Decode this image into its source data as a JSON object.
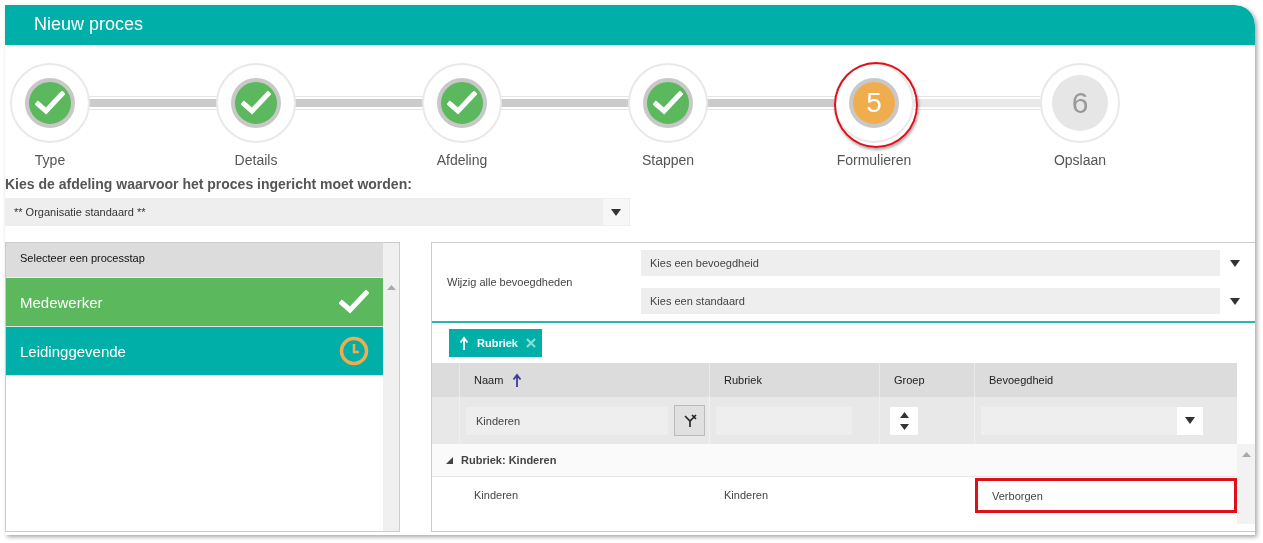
{
  "window": {
    "title": "Nieuw proces"
  },
  "steps": [
    {
      "label": "Type",
      "completed": true,
      "selected": false
    },
    {
      "label": "Details",
      "completed": true,
      "selected": false
    },
    {
      "label": "Afdeling",
      "completed": true,
      "selected": false
    },
    {
      "label": "Stappen",
      "completed": true,
      "selected": false
    },
    {
      "label": "Formulieren",
      "completed": false,
      "selected": true,
      "number": "5",
      "annotated": true
    },
    {
      "label": "Opslaan",
      "completed": false,
      "selected": false,
      "number": "6"
    }
  ],
  "department": {
    "label": "Kies de afdeling waarvoor het proces ingericht moet worden:",
    "value": "** Organisatie standaard **"
  },
  "process_steps": {
    "header": "Selecteer een processtap",
    "items": [
      {
        "label": "Medewerker",
        "completed": true
      },
      {
        "label": "Leidinggevende",
        "completed": false
      }
    ]
  },
  "bulk_edit": {
    "label": "Wijzig alle bevoegdheden",
    "selects": [
      {
        "placeholder": "Kies een bevoegdheid"
      },
      {
        "placeholder": "Kies een standaard"
      }
    ]
  },
  "grouping": [
    {
      "label": "Rubriek",
      "sorted_ascending": true
    }
  ],
  "table": {
    "columns": [
      {
        "label": "Naam",
        "sorted_ascending": true
      },
      {
        "label": "Rubriek",
        "sorted_ascending": false
      },
      {
        "label": "Groep",
        "sorted_ascending": false
      },
      {
        "label": "Bevoegdheid",
        "sorted_ascending": false
      }
    ],
    "filter": {
      "naam": "Kinderen"
    },
    "groups": [
      {
        "label": "Rubriek: Kinderen",
        "expanded": true,
        "rows": [
          {
            "naam": "Kinderen",
            "rubriek": "Kinderen",
            "bevoegdheid": "Verborgen",
            "bevoegdheid_annotated": true
          }
        ]
      }
    ]
  }
}
